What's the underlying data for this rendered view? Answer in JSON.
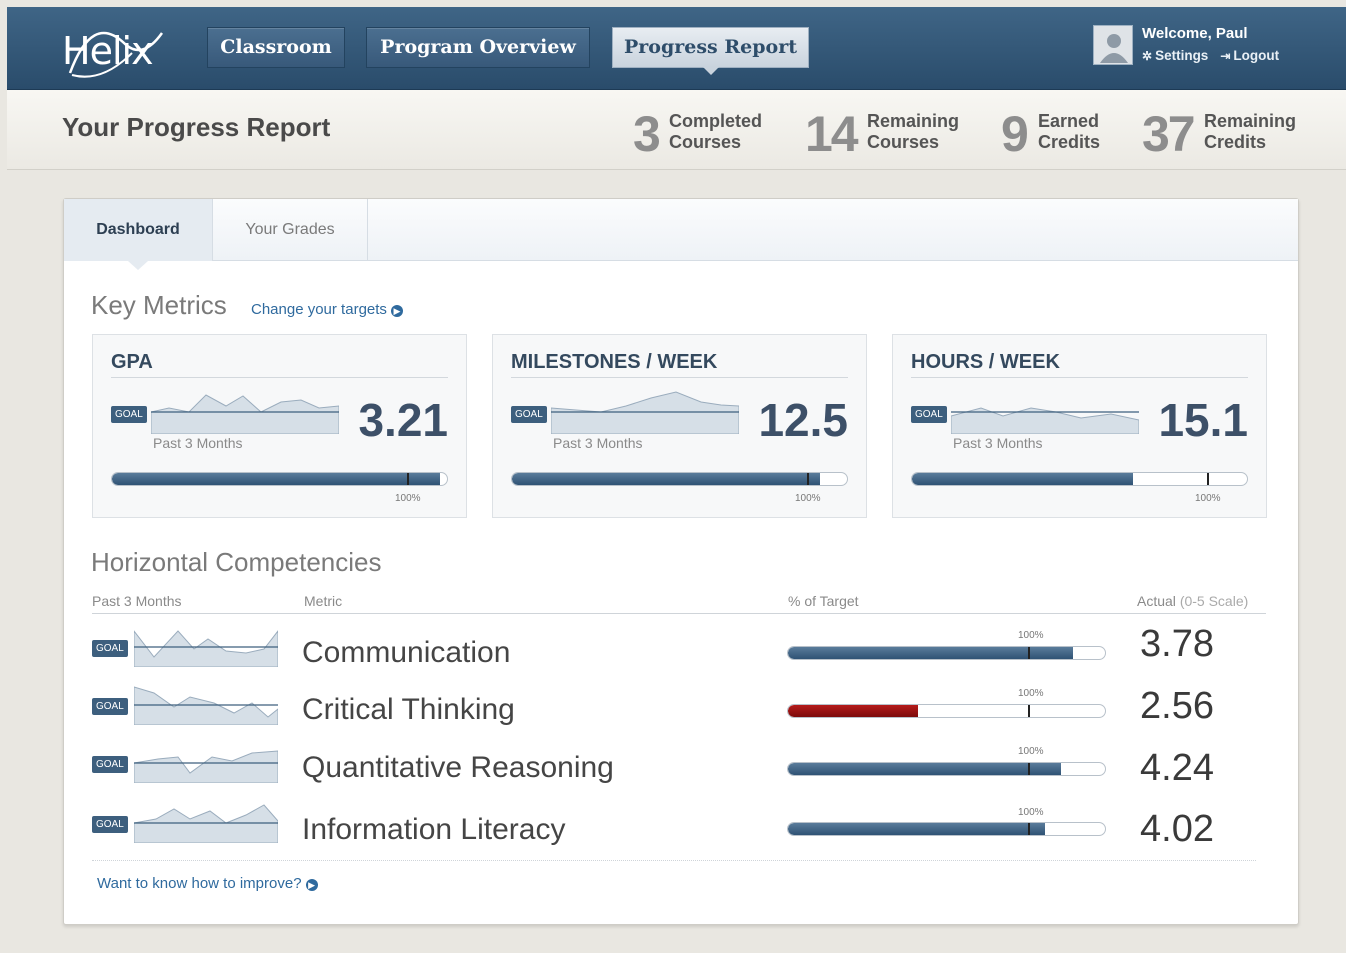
{
  "app": {
    "logo": "Helix",
    "nav": [
      {
        "label": "Classroom",
        "active": false
      },
      {
        "label": "Program Overview",
        "active": false
      },
      {
        "label": "Progress Report",
        "active": true
      }
    ],
    "user": {
      "welcome": "Welcome, Paul",
      "settings_label": "Settings",
      "logout_label": "Logout"
    }
  },
  "header": {
    "title": "Your Progress Report",
    "stats": [
      {
        "number": "3",
        "line1": "Completed",
        "line2": "Courses"
      },
      {
        "number": "14",
        "line1": "Remaining",
        "line2": "Courses"
      },
      {
        "number": "9",
        "line1": "Earned",
        "line2": "Credits"
      },
      {
        "number": "37",
        "line1": "Remaining",
        "line2": "Credits"
      }
    ]
  },
  "tabs": [
    {
      "label": "Dashboard",
      "active": true
    },
    {
      "label": "Your Grades",
      "active": false
    }
  ],
  "key_metrics": {
    "title": "Key Metrics",
    "change_link": "Change your targets",
    "goal_tag": "GOAL",
    "period": "Past 3 Months",
    "target_label": "100%",
    "items": [
      {
        "title": "GPA",
        "value": "3.21",
        "progress": 0.98,
        "target": 0.88
      },
      {
        "title": "MILESTONES / WEEK",
        "value": "12.5",
        "progress": 0.92,
        "target": 0.88
      },
      {
        "title": "HOURS / WEEK",
        "value": "15.1",
        "progress": 0.66,
        "target": 0.88
      }
    ]
  },
  "competencies": {
    "title": "Horizontal Competencies",
    "headers": {
      "period": "Past 3 Months",
      "metric": "Metric",
      "target": "% of Target",
      "actual": "Actual",
      "actual_scale": "(0-5 Scale)"
    },
    "goal_tag": "GOAL",
    "target_label": "100%",
    "rows": [
      {
        "name": "Communication",
        "value": "3.78",
        "progress": 0.9,
        "status": "ok"
      },
      {
        "name": "Critical Thinking",
        "value": "2.56",
        "progress": 0.41,
        "status": "below"
      },
      {
        "name": "Quantitative Reasoning",
        "value": "4.24",
        "progress": 0.86,
        "status": "ok"
      },
      {
        "name": "Information Literacy",
        "value": "4.02",
        "progress": 0.81,
        "status": "ok"
      }
    ],
    "improve_link": "Want to know how to improve?"
  },
  "colors": {
    "nav_bg": "#2f5373",
    "accent": "#3d5f7e",
    "link": "#2f6a9e",
    "below_target": "#9a1010"
  }
}
